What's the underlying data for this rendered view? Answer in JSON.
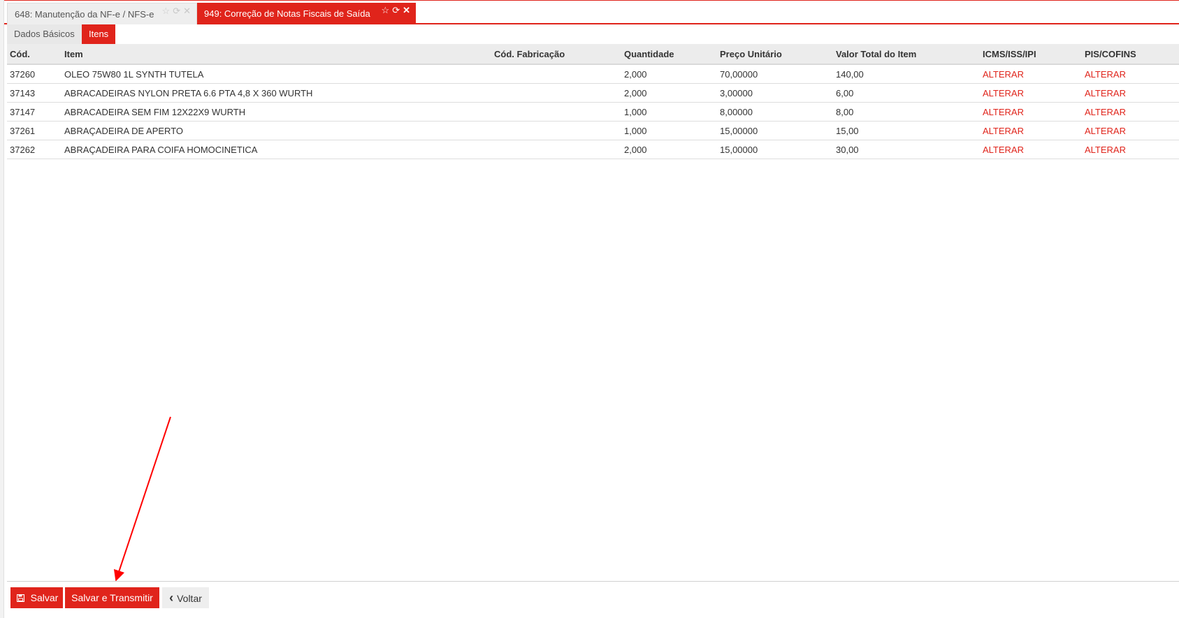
{
  "tabs": [
    {
      "label": "648: Manutenção da NF-e / NFS-e",
      "active": false,
      "icons": [
        "star-icon",
        "refresh-icon",
        "close-icon"
      ]
    },
    {
      "label": "949: Correção de Notas Fiscais de Saída",
      "active": true,
      "icons": [
        "star-icon",
        "refresh-icon",
        "close-icon"
      ]
    }
  ],
  "icon_glyphs": {
    "star": "☆",
    "refresh": "⟳",
    "close": "✕",
    "save": "💾",
    "back": "‹"
  },
  "subtabs": [
    {
      "label": "Dados Básicos",
      "active": false
    },
    {
      "label": "Itens",
      "active": true
    }
  ],
  "table": {
    "columns": [
      "Cód.",
      "Item",
      "Cód. Fabricação",
      "Quantidade",
      "Preço Unitário",
      "Valor Total do Item",
      "ICMS/ISS/IPI",
      "PIS/COFINS"
    ],
    "rows": [
      {
        "cod": "37260",
        "item": "OLEO 75W80 1L SYNTH TUTELA",
        "fab": "",
        "qtd": "2,000",
        "preco": "70,00000",
        "valor": "140,00",
        "icms": "ALTERAR",
        "pis": "ALTERAR"
      },
      {
        "cod": "37143",
        "item": "ABRACADEIRAS NYLON PRETA 6.6 PTA 4,8 X 360 WURTH",
        "fab": "",
        "qtd": "2,000",
        "preco": "3,00000",
        "valor": "6,00",
        "icms": "ALTERAR",
        "pis": "ALTERAR"
      },
      {
        "cod": "37147",
        "item": "ABRACADEIRA SEM FIM 12X22X9 WURTH",
        "fab": "",
        "qtd": "1,000",
        "preco": "8,00000",
        "valor": "8,00",
        "icms": "ALTERAR",
        "pis": "ALTERAR"
      },
      {
        "cod": "37261",
        "item": "ABRAÇADEIRA DE APERTO",
        "fab": "",
        "qtd": "1,000",
        "preco": "15,00000",
        "valor": "15,00",
        "icms": "ALTERAR",
        "pis": "ALTERAR"
      },
      {
        "cod": "37262",
        "item": "ABRAÇADEIRA PARA COIFA HOMOCINETICA",
        "fab": "",
        "qtd": "2,000",
        "preco": "15,00000",
        "valor": "30,00",
        "icms": "ALTERAR",
        "pis": "ALTERAR"
      }
    ]
  },
  "footer": {
    "save_label": "Salvar",
    "save_transmit_label": "Salvar e Transmitir",
    "back_label": "Voltar"
  },
  "colors": {
    "accent": "#e0241b",
    "annotation_arrow": "#ff0000"
  }
}
